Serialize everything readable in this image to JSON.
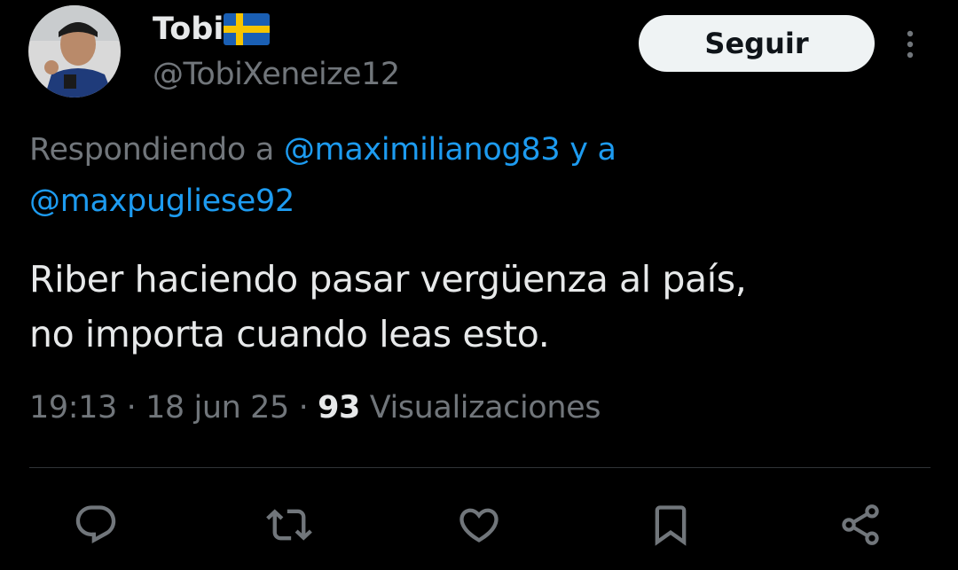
{
  "author": {
    "display_name": "Tobi",
    "handle": "@TobiXeneize12",
    "avatar_icon": "user-avatar",
    "flag_icon": "sweden-flag-icon"
  },
  "header": {
    "follow_label": "Seguir",
    "more_icon": "more-vertical-icon"
  },
  "reply": {
    "prefix": "Respondiendo a ",
    "mention_1": "@maximilianog83",
    "joiner": " y a",
    "mention_2": "@maxpugliese92"
  },
  "tweet": {
    "text_line_1": "Riber haciendo pasar vergüenza al país,",
    "text_line_2": "no importa cuando leas esto."
  },
  "meta": {
    "time": "19:13",
    "separator_1": " · ",
    "date": "18 jun 25",
    "separator_2": " · ",
    "views_count": "93",
    "views_label": " Visualizaciones"
  },
  "actions": [
    {
      "icon": "reply-icon"
    },
    {
      "icon": "retweet-icon"
    },
    {
      "icon": "like-icon"
    },
    {
      "icon": "bookmark-icon"
    },
    {
      "icon": "share-icon"
    }
  ],
  "colors": {
    "background": "#000000",
    "text_primary": "#e7e9ea",
    "text_secondary": "#71767b",
    "mention": "#1d9bf0",
    "follow_button_bg": "#eff3f4",
    "follow_button_text": "#0f1419",
    "divider": "#2f3336"
  }
}
